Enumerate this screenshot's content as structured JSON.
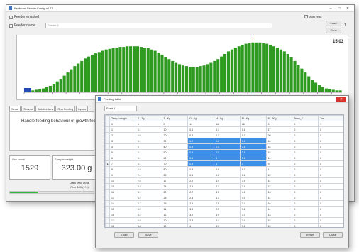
{
  "main_window": {
    "title": "Keyboard Feeder Config v0.47",
    "controls": {
      "minimize": "–",
      "maximize": "□",
      "close": "✕"
    },
    "feeder_enabled_label": "Feeder enabled",
    "feeder_name_label": "Feeder name",
    "feeder_name_value": "Feeder 1",
    "auto_read_label": "Auto read",
    "read_button": "Load",
    "save_button": "Save",
    "small_side_text": "1",
    "chart_value": "15.03",
    "tabs": [
      "Serial",
      "Servos",
      "Sub-feeders",
      "Run feeding",
      "Inputs"
    ],
    "body_text": "Handle feeding behaviour of growth fee",
    "weight_caption_left": "Grn count",
    "weight_value_left": "1529",
    "weight_caption_right": "Sample weight",
    "weight_value_right": "323.00 g",
    "status_line_1": "Data read at/ok",
    "status_line_2": "Rise 100 (1%)",
    "progress": 0.34,
    "colors": {
      "bar": "#2e9a1f",
      "marker": "#d33a2c",
      "accent_bar": "#2249b8",
      "progress": "#33b93a",
      "selection": "#3d8fe8"
    }
  },
  "chart_data": {
    "type": "bar",
    "values": [
      3,
      3,
      3,
      4,
      5,
      6,
      8,
      10,
      13,
      17,
      21,
      26,
      31,
      36,
      41,
      45,
      49,
      53,
      56,
      59,
      61,
      63,
      65,
      67,
      68,
      69,
      70,
      71,
      71,
      72,
      72,
      72,
      72,
      71,
      70,
      69,
      67,
      65,
      62,
      59,
      55,
      52,
      49,
      46,
      44,
      42,
      41,
      40,
      40,
      40,
      41,
      42,
      44,
      46,
      49,
      52,
      56,
      60,
      64,
      67,
      70,
      72,
      74,
      76,
      77,
      78,
      78,
      78,
      77,
      76,
      74,
      72,
      70,
      67,
      64,
      60,
      55,
      49,
      43,
      37,
      31,
      25,
      20,
      15,
      11,
      8,
      6,
      5,
      4,
      3,
      3
    ],
    "ylim": [
      0,
      80
    ],
    "marker_index": 65,
    "title": "",
    "xlabel": "",
    "ylabel": ""
  },
  "dialog": {
    "title": "Feeding table",
    "controls": {
      "close": "✕"
    },
    "field_value": "Feed 1",
    "columns": [
      "Temp / weight",
      "D - Tg",
      "T - Kg",
      "D - Kg",
      "M - Kg",
      "M - Kg",
      "M - 50g",
      "Temp_C",
      "Tar"
    ],
    "rows": [
      [
        "0",
        "4",
        "0",
        "14",
        "14",
        "16",
        "0",
        "0",
        "1"
      ],
      [
        "1",
        "0.1",
        "10",
        "0.1",
        "0.1",
        "0.1",
        "17",
        "0",
        "0"
      ],
      [
        "2",
        "0.6",
        "20",
        "0.2",
        "0.2",
        "0.2",
        "20",
        "0",
        "0"
      ],
      [
        "3",
        "0.1",
        "30",
        "0.2",
        "0.2",
        "0.2",
        "18",
        "0",
        "0"
      ],
      [
        "4",
        "0",
        "40",
        "0.5",
        "0.3",
        "0.5",
        "18",
        "0",
        "0"
      ],
      [
        "5",
        "0.1",
        "50",
        "0.5",
        "0.5",
        "0.5",
        "15",
        "0",
        "0"
      ],
      [
        "6",
        "0.1",
        "60",
        "0.4",
        "4",
        "0.6",
        "16",
        "0",
        "0"
      ],
      [
        "7",
        "0.1",
        "70",
        "0.5",
        "1",
        "1",
        "9",
        "0",
        "0"
      ],
      [
        "8",
        "2.2",
        "80",
        "0.5",
        "0.6",
        "0.2",
        "1",
        "0",
        "0"
      ],
      [
        "9",
        "2.1",
        "22",
        "0.6",
        "0.2",
        "0.6",
        "12",
        "0",
        "0"
      ],
      [
        "10",
        "2.6",
        "17",
        "2.2",
        "4.9",
        "3.9",
        "14",
        "0",
        "0"
      ],
      [
        "11",
        "3.8",
        "24",
        "2.6",
        "3.1",
        "3.1",
        "12",
        "0",
        "0"
      ],
      [
        "12",
        "3.1",
        "20",
        "2.7",
        "3.5",
        "4.5",
        "13",
        "0",
        "0"
      ],
      [
        "13",
        "3.2",
        "25",
        "2.5",
        "3.1",
        "4.0",
        "14",
        "0",
        "0"
      ],
      [
        "14",
        "3.7",
        "15",
        "2.6",
        "2.8",
        "3.3",
        "16",
        "0",
        "0"
      ],
      [
        "15",
        "4.2",
        "14",
        "3.8",
        "2.5",
        "3.8",
        "14",
        "0",
        "0"
      ],
      [
        "16",
        "4.2",
        "12",
        "3.2",
        "3.9",
        "3.3",
        "13",
        "0",
        "0"
      ],
      [
        "17",
        "4.8",
        "10",
        "3.3",
        "3.4",
        "3.0",
        "15",
        "0",
        "0"
      ],
      [
        "18",
        "3.8",
        "10",
        "4",
        "3.3",
        "3.5",
        "15",
        "0",
        "0"
      ]
    ],
    "selected_cells": [
      [
        3,
        3
      ],
      [
        3,
        4
      ],
      [
        3,
        5
      ],
      [
        4,
        3
      ],
      [
        4,
        4
      ],
      [
        4,
        5
      ],
      [
        5,
        3
      ],
      [
        5,
        4
      ],
      [
        5,
        5
      ],
      [
        6,
        3
      ],
      [
        6,
        4
      ],
      [
        6,
        5
      ],
      [
        7,
        3
      ],
      [
        7,
        4
      ],
      [
        7,
        5
      ]
    ],
    "buttons": {
      "load": "Load",
      "save": "Save",
      "reset": "Reset",
      "close": "Close"
    }
  }
}
